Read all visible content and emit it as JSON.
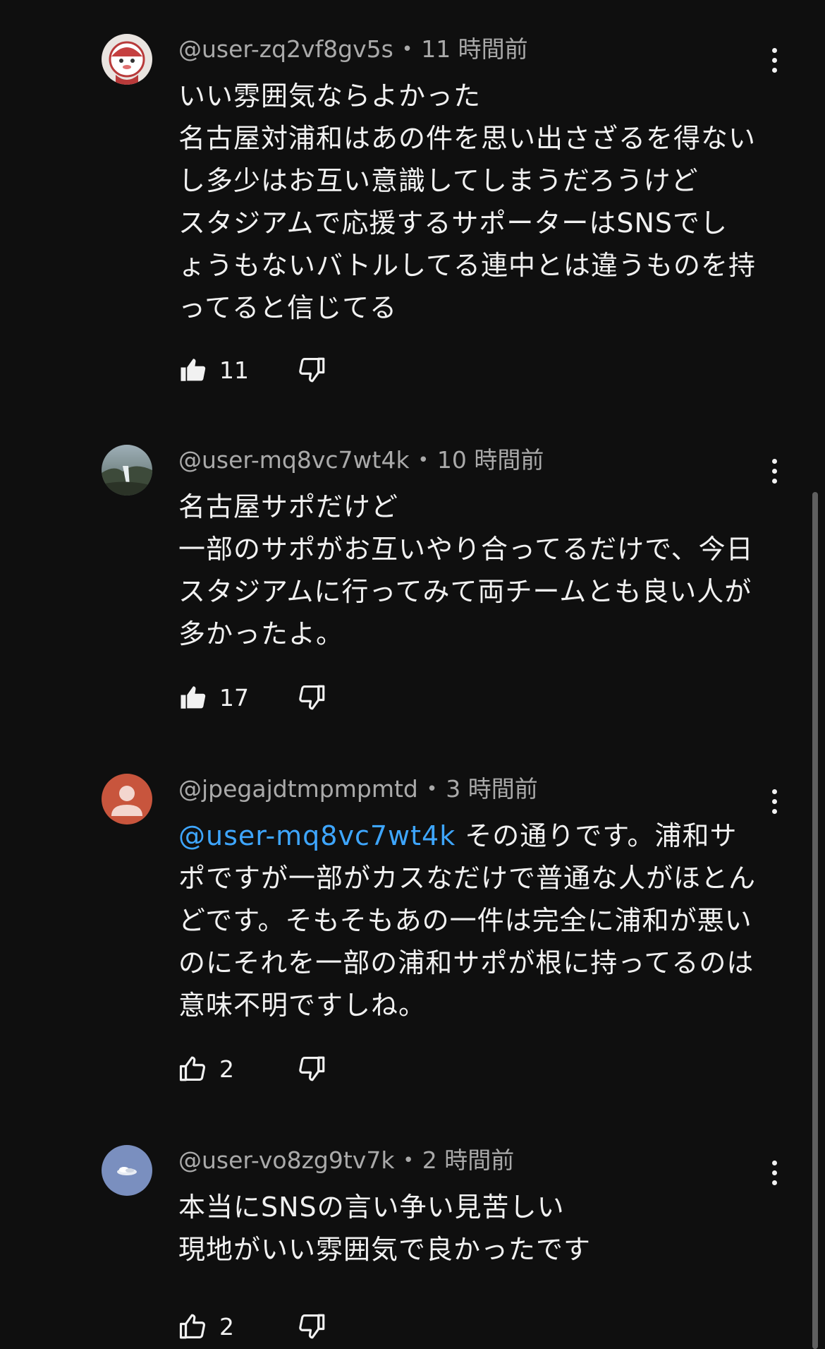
{
  "comments": [
    {
      "handle": "@user-zq2vf8gv5s",
      "time": "11 時間前",
      "lines": [
        "いい雰囲気ならよかった",
        "名古屋対浦和はあの件を思い出さざるを得ない",
        "し多少はお互い意識してしまうだろうけど",
        "スタジアムで応援するサポーターはSNSでし",
        "ょうもないバトルしてる連中とは違うものを持",
        "ってると信じてる"
      ],
      "likes": "11",
      "liked": true,
      "avatar_icon": "anime-character-avatar"
    },
    {
      "handle": "@user-mq8vc7wt4k",
      "time": "10 時間前",
      "lines": [
        "名古屋サポだけど",
        "一部のサポがお互いやり合ってるだけで、今日",
        "スタジアムに行ってみて両チームとも良い人が",
        "多かったよ。"
      ],
      "likes": "17",
      "liked": true,
      "avatar_icon": "landscape-photo-avatar"
    },
    {
      "handle": "@jpegajdtmpmpmtd",
      "time": "3 時間前",
      "mention": "@user-mq8vc7wt4k",
      "first_line_rest": " その通りです。浦和サ",
      "lines": [
        "ポですが一部がカスなだけで普通な人がほとん",
        "どです。そもそもあの一件は完全に浦和が悪い",
        "のにそれを一部の浦和サポが根に持ってるのは",
        "意味不明ですしね。"
      ],
      "likes": "2",
      "liked": false,
      "avatar_icon": "default-person-avatar"
    },
    {
      "handle": "@user-vo8zg9tv7k",
      "time": "2 時間前",
      "lines": [
        "本当にSNSの言い争い見苦しい",
        "現地がいい雰囲気で良かったです"
      ],
      "likes": "2",
      "liked": false,
      "avatar_icon": "cloud-avatar"
    }
  ],
  "meta_separator": "•",
  "colors": {
    "background": "#0f0f0f",
    "text": "#f1f1f1",
    "meta": "#aaaaaa",
    "mention": "#3ea6ff",
    "avatar_red": "#c8553d"
  }
}
